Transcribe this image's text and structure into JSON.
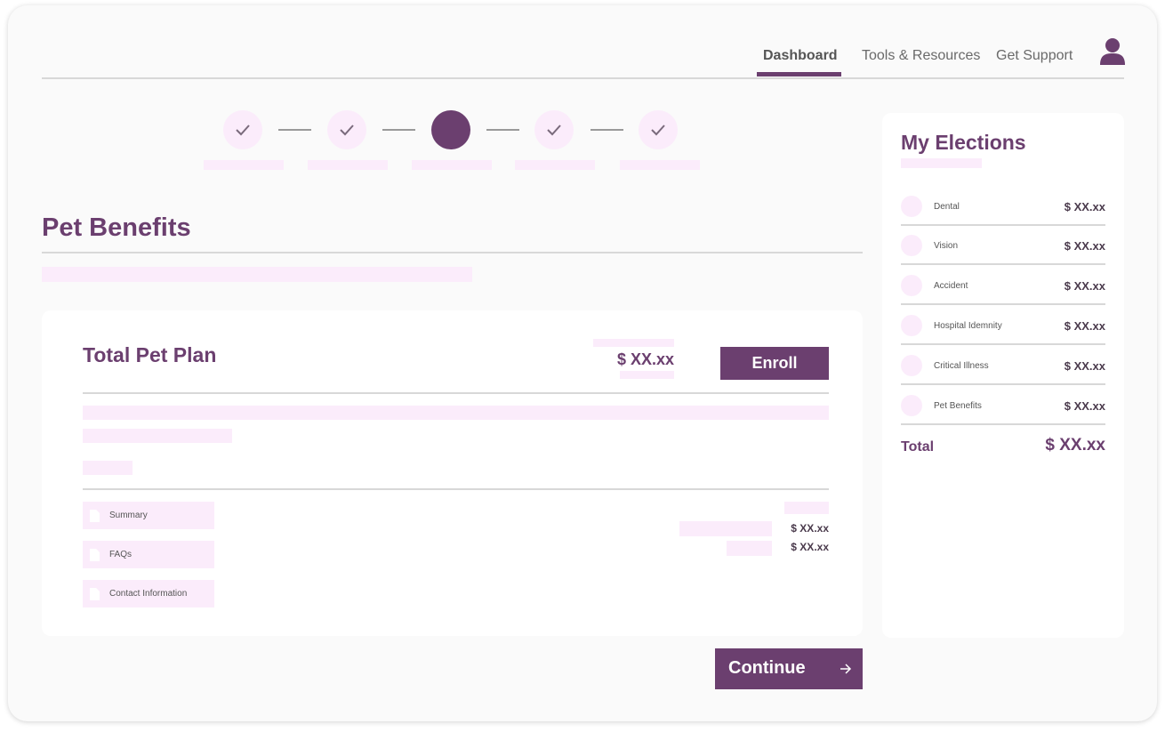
{
  "nav": {
    "items": [
      {
        "label": "Dashboard",
        "active": true
      },
      {
        "label": "Tools & Resources",
        "active": false
      },
      {
        "label": "Get Support",
        "active": false
      }
    ],
    "account_icon": "user-icon"
  },
  "stepper": {
    "steps": [
      {
        "status": "complete",
        "icon": "check-icon"
      },
      {
        "status": "complete",
        "icon": "check-icon"
      },
      {
        "status": "current"
      },
      {
        "status": "complete",
        "icon": "check-icon"
      },
      {
        "status": "complete",
        "icon": "check-icon"
      }
    ]
  },
  "page": {
    "title": "Pet Benefits"
  },
  "plan": {
    "title": "Total Pet Plan",
    "price": "$ XX.xx",
    "enroll_label": "Enroll",
    "documents": [
      {
        "label": "Summary",
        "icon": "document-icon"
      },
      {
        "label": "FAQs",
        "icon": "document-icon"
      },
      {
        "label": "Contact Information",
        "icon": "document-icon"
      }
    ],
    "costs": [
      "$ XX.xx",
      "$ XX.xx"
    ]
  },
  "continue_label": "Continue",
  "elections": {
    "title": "My Elections",
    "items": [
      {
        "name": "Dental",
        "price": "$ XX.xx"
      },
      {
        "name": "Vision",
        "price": "$ XX.xx"
      },
      {
        "name": "Accident",
        "price": "$ XX.xx"
      },
      {
        "name": "Hospital Idemnity",
        "price": "$ XX.xx"
      },
      {
        "name": "Critical Illness",
        "price": "$ XX.xx"
      },
      {
        "name": "Pet Benefits",
        "price": "$ XX.xx"
      }
    ],
    "total_label": "Total",
    "total_value": "$ XX.xx"
  },
  "colors": {
    "brand": "#6b3f6f",
    "placeholder": "#fbecfb",
    "divider": "#d8d8d8",
    "background": "#fafafa"
  }
}
